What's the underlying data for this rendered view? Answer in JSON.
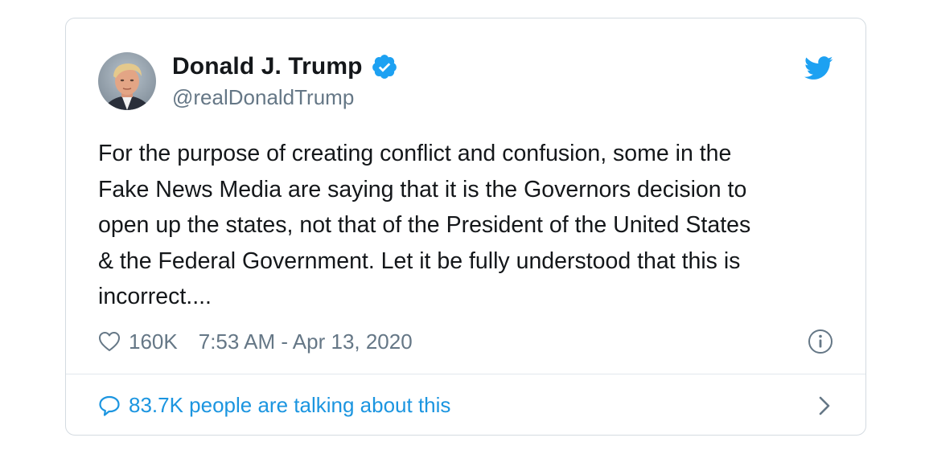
{
  "user": {
    "display_name": "Donald J. Trump",
    "handle": "@realDonaldTrump",
    "verified_icon": "verified-badge-icon",
    "avatar_icon": "avatar"
  },
  "tweet": {
    "text": "For the purpose of creating conflict and confusion, some in the\nFake News Media are saying that it is the Governors decision to\nopen up the states, not that of the President of the United States\n& the Federal Government. Let it be fully understood that this is\nincorrect....",
    "likes": "160K",
    "timestamp": "7:53 AM - Apr 13, 2020"
  },
  "footer": {
    "talking_label": "83.7K people are talking about this"
  },
  "icons": {
    "brand": "twitter-bird-icon",
    "like": "heart-icon",
    "info": "info-icon",
    "reply": "speech-bubble-icon",
    "more": "chevron-right-icon"
  },
  "colors": {
    "twitter_blue": "#1da1f2",
    "link_blue": "#1b95e0",
    "text": "#14171a",
    "secondary": "#657786",
    "border": "#d4dbe1"
  }
}
